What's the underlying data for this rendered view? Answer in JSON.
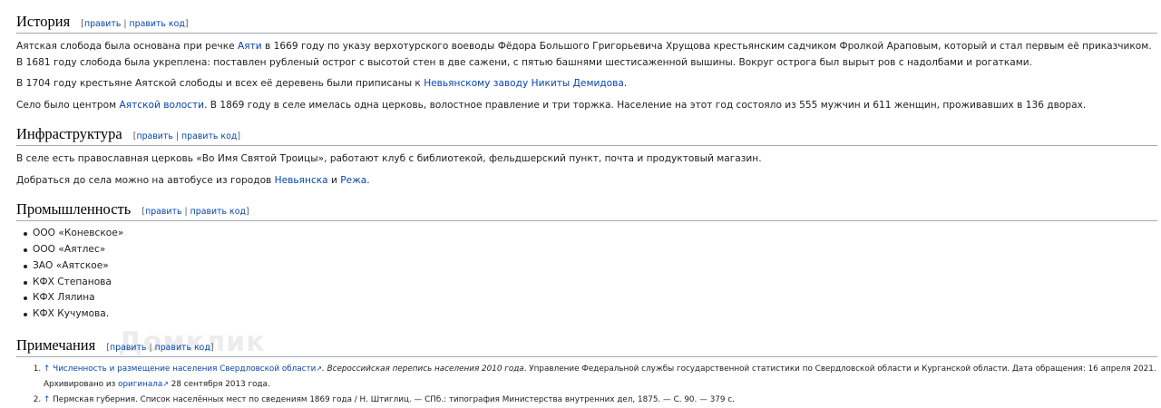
{
  "edit_links": {
    "open": "[",
    "edit": "править",
    "sep": " | ",
    "edit_code": "править код",
    "close": "]"
  },
  "history": {
    "title": "История",
    "p1": {
      "t1": "Аятская слобода была основана при речке ",
      "link1": "Аяти",
      "t2": " в 1669 году по указу верхотурского воеводы Фёдора Большого Григорьевича Хрущова крестьянским садчиком Фролкой Араповым, который и стал первым её приказчиком. В 1681 году слобода была укреплена: поставлен рубленый острог с высотой стен в две сажени, с пятью башнями шестисаженной вышины. Вокруг острога был вырыт ров с надолбами и рогатками."
    },
    "p2": {
      "t1": "В 1704 году крестьяне Аятской слободы и всех её деревень были приписаны к ",
      "link1": "Невьянскому заводу Никиты Демидова",
      "t2": "."
    },
    "p3": {
      "t1": "Село было центром ",
      "link1": "Аятской волости",
      "t2": ". В 1869 году в селе имелась одна церковь, волостное правление и три торжка. Население на этот год состояло из 555 мужчин и 611 женщин, проживавших в 136 дворах."
    }
  },
  "infrastructure": {
    "title": "Инфраструктура",
    "p1": "В селе есть православная церковь «Во Имя Святой Троицы», работают клуб с библиотекой, фельдшерский пункт, почта и продуктовый магазин.",
    "p2": {
      "t1": "Добраться до села можно на автобусе из городов ",
      "link1": "Невьянска",
      "t2": " и ",
      "link2": "Режа",
      "t3": "."
    }
  },
  "industry": {
    "title": "Промышленность",
    "items": [
      "ООО «Коневское»",
      "ООО «Аятлес»",
      "ЗАО «Аятское»",
      "КФХ Степанова",
      "КФХ Лялина",
      "КФХ Кучумова."
    ]
  },
  "notes": {
    "title": "Примечания",
    "n1": {
      "arrow": "↑",
      "link": "Численность и размещение населения Свердловской области",
      "ext": "↗",
      "t1": ". Всероссийская перепись населения 2010 года",
      "t2": ". Управление Федеральной службы государственной статистики по Свердловской области и Курганской области. ",
      "date": "Дата обращения: 16 апреля 2021.",
      "archived": "Архивировано из ",
      "archived_link": "оригинала",
      "archived_date": " 28 сентября 2013 года."
    },
    "n2": {
      "arrow": "↑",
      "text": "Пермская губерния. Список населённых мест по сведениям 1869 года / Н. Штиглиц. — СПб.: типография Министерства внутренних дел, 1875. — С. 90. — 379 с."
    }
  },
  "watermark": "Домклик"
}
